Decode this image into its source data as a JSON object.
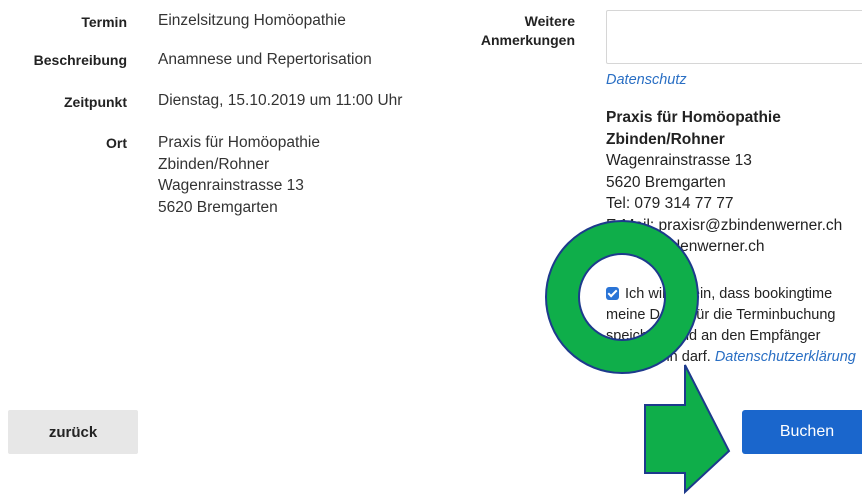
{
  "details": {
    "termin_label": "Termin",
    "termin_value": "Einzelsitzung Homöopathie",
    "beschreibung_label": "Beschreibung",
    "beschreibung_value": "Anamnese und Repertorisation",
    "zeitpunkt_label": "Zeitpunkt",
    "zeitpunkt_value": "Dienstag, 15.10.2019 um 11:00 Uhr",
    "ort_label": "Ort",
    "ort_lines": [
      "Praxis für Homöopathie",
      "Zbinden/Rohner",
      "Wagenrainstrasse 13",
      "5620 Bremgarten"
    ]
  },
  "form": {
    "anmerkungen_label_1": "Weitere",
    "anmerkungen_label_2": "Anmerkungen",
    "anmerkungen_value": "",
    "datenschutz_link": "Datenschutz"
  },
  "address": {
    "name_1": "Praxis für Homöopathie",
    "name_2": "Zbinden/Rohner",
    "street": "Wagenrainstrasse 13",
    "city": "5620 Bremgarten",
    "tel": "Tel: 079 314 77 77",
    "email": "E-Mail: praxisr@zbindenwerner.ch",
    "web": "www.zbindenwerner.ch"
  },
  "consent": {
    "checked": true,
    "line_1": "Ich willige ein, dass bookingtime",
    "line_2": "meine Daten für die Terminbuchung",
    "line_3": "speichern und an den Empfänger",
    "line_4_text": "übermitteln darf.",
    "line_4_link": "Datenschutzerklärung"
  },
  "buttons": {
    "back_label": "zurück",
    "book_label": "Buchen"
  },
  "colors": {
    "accent": "#1a66cc",
    "link": "#2a6fc4",
    "annotation_fill": "#0fae4a",
    "annotation_stroke": "#1d3a8c"
  }
}
